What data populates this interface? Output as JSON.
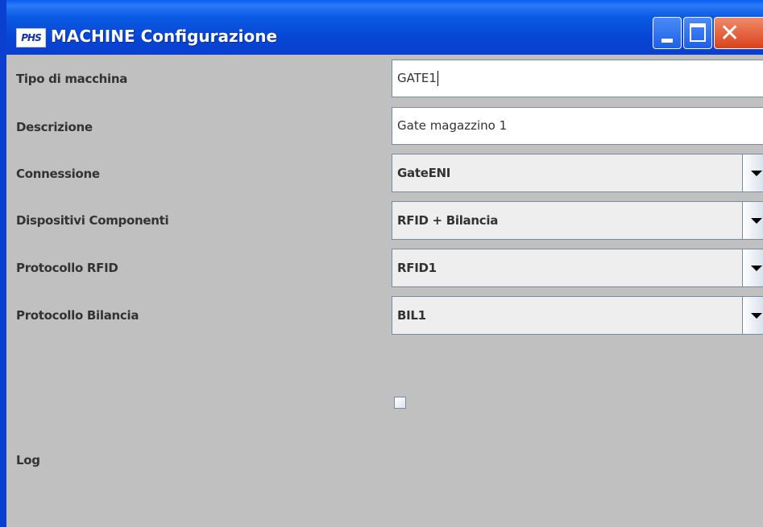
{
  "window": {
    "icon_text": "PHS",
    "title": "MACHINE Configurazione",
    "controls": {
      "minimize": "minimize",
      "maximize": "maximize",
      "close": "close"
    }
  },
  "form": {
    "tipo_label": "Tipo di macchina",
    "tipo_value": "GATE1",
    "descrizione_label": "Descrizione",
    "descrizione_value": "Gate magazzino 1",
    "connessione_label": "Connessione",
    "connessione_value": "GateENI",
    "dispositivi_label": "Dispositivi Componenti",
    "dispositivi_value": "RFID + Bilancia",
    "protocollo_rfid_label": "Protocollo RFID",
    "protocollo_rfid_value": "RFID1",
    "protocollo_bilancia_label": "Protocollo Bilancia",
    "protocollo_bilancia_value": "BIL1",
    "log_label": "Log",
    "log_checked": false
  },
  "colors": {
    "titlebar": "#0a5ee8",
    "panel": "#c0c0c0",
    "close_button": "#e0502c"
  },
  "icons": [
    "phs-logo-icon",
    "minimize-icon",
    "maximize-icon",
    "close-icon",
    "chevron-down-icon"
  ]
}
